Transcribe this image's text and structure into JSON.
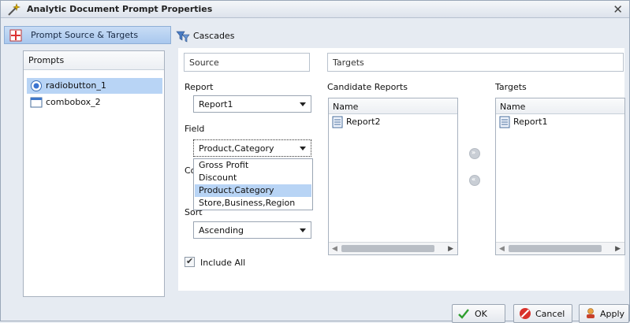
{
  "window": {
    "title": "Analytic Document Prompt Properties",
    "close_glyph": "✕"
  },
  "nav": {
    "prompt_source_tab": "Prompt Source & Targets",
    "cascades_tab": "Cascades"
  },
  "prompts": {
    "header": "Prompts",
    "items": [
      {
        "label": "radiobutton_1",
        "icon": "radio-button-icon",
        "selected": true
      },
      {
        "label": "combobox_2",
        "icon": "combobox-icon",
        "selected": false
      }
    ]
  },
  "source": {
    "header": "Source",
    "report_label": "Report",
    "report_value": "Report1",
    "field_label": "Field",
    "field_value": "Product,Category",
    "field_options": [
      "Gross Profit",
      "Discount",
      "Product,Category",
      "Store,Business,Region"
    ],
    "field_highlighted": "Product,Category",
    "hidden_label_partial": "Co",
    "sort_label": "Sort",
    "sort_value": "Ascending",
    "include_all_label": "Include All",
    "include_all_checked": true
  },
  "targets": {
    "header": "Targets",
    "candidate_label": "Candidate Reports",
    "targets_label": "Targets",
    "column_name": "Name",
    "candidate_rows": [
      "Report2"
    ],
    "target_rows": [
      "Report1"
    ],
    "move_right_glyph": "»",
    "move_left_glyph": "«"
  },
  "footer": {
    "ok": "OK",
    "cancel": "Cancel",
    "apply": "Apply"
  },
  "colors": {
    "selection": "#b8d4f5",
    "tab_active": "#a9c8ee",
    "ok_check": "#2f9e2f",
    "cancel_red": "#d9302b"
  }
}
